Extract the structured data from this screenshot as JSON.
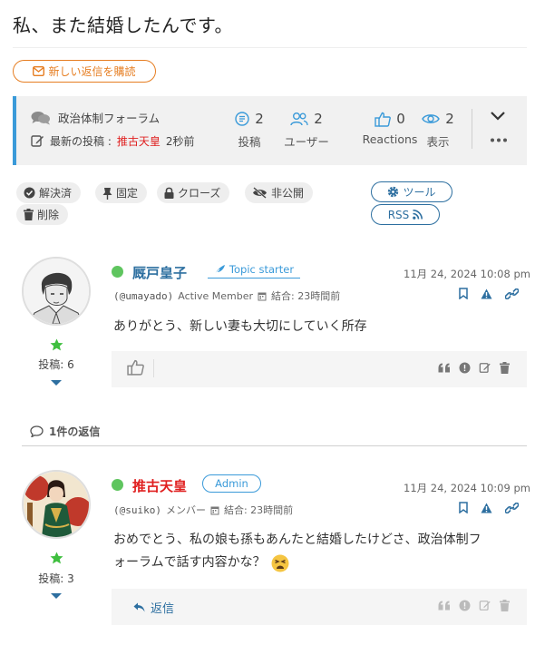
{
  "topic": {
    "title": "私、また結婚したんです。"
  },
  "subscribe": {
    "label": "新しい返信を購読"
  },
  "info": {
    "forum_name": "政治体制フォーラム",
    "last_post_label": "最新の投稿 :",
    "last_post_author": "推古天皇",
    "last_post_time": "2秒前",
    "stats": [
      {
        "value": "2",
        "label": "投稿",
        "icon": "posts-icon"
      },
      {
        "value": "2",
        "label": "ユーザー",
        "icon": "users-icon"
      },
      {
        "value": "0",
        "label": "Reactions",
        "icon": "thumbs-up-icon"
      },
      {
        "value": "2",
        "label": "表示",
        "icon": "eye-icon"
      }
    ]
  },
  "moderation": {
    "solved": "解決済",
    "sticky": "固定",
    "close": "クローズ",
    "private": "非公開",
    "delete": "削除",
    "tools": "ツール",
    "rss": "RSS"
  },
  "posts": [
    {
      "username": "厩戸皇子",
      "badge": "Topic starter",
      "handle": "(@umayado)",
      "role": "Active Member",
      "joined": "結合: 23時間前",
      "date": "11月 24, 2024 10:08 pm",
      "text": "ありがとう、新しい妻も大切にしていく所存",
      "posts_count": "投稿: 6"
    },
    {
      "username": "推古天皇",
      "badge": "Admin",
      "handle": "(@suiko)",
      "role": "メンバー",
      "joined": "結合: 23時間前",
      "date": "11月 24, 2024 10:09 pm",
      "text_line1": "おめでとう、私の娘も孫もあんたと結婚したけどさ、政治体制フ",
      "text_line2": "ォーラムで話す内容かな？",
      "posts_count": "投稿: 3",
      "reply_label": "返信"
    }
  ],
  "replies_header": "1件の返信",
  "colors": {
    "accent": "#3a9ad9",
    "orange": "#e67e22",
    "admin_red": "#e02020",
    "online": "#5fc55f",
    "link_blue": "#2d6fa0"
  }
}
